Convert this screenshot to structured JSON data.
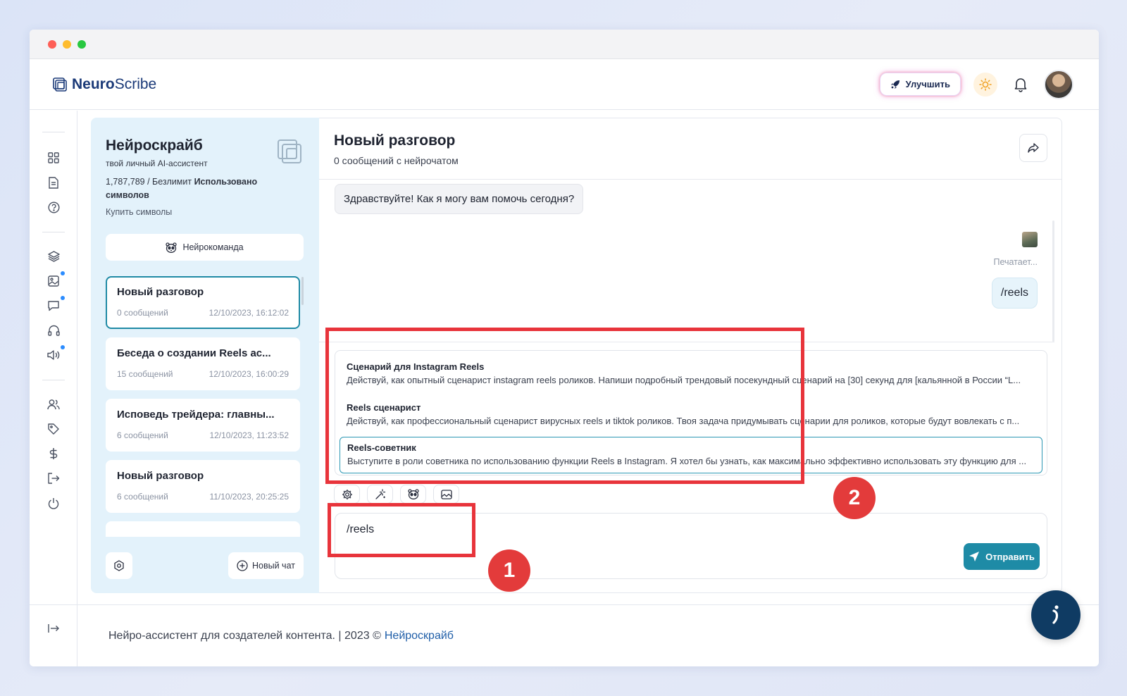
{
  "app": {
    "name_bold": "Neuro",
    "name_rest": "Scribe"
  },
  "header": {
    "upgrade_label": "Улучшить"
  },
  "panel": {
    "title": "Нейроскрайб",
    "subtitle": "твой личный AI-ассистент",
    "usage_count": "1,787,789 / Безлимит ",
    "usage_label": "Использовано символов",
    "buy_label": "Купить символы",
    "team_label": "Нейрокоманда",
    "new_chat_label": "Новый чат",
    "chats": [
      {
        "title": "Новый разговор",
        "count": "0 сообщений",
        "date": "12/10/2023, 16:12:02"
      },
      {
        "title": "Беседа о создании Reels ас...",
        "count": "15 сообщений",
        "date": "12/10/2023, 16:00:29"
      },
      {
        "title": "Исповедь трейдера: главны...",
        "count": "6 сообщений",
        "date": "12/10/2023, 11:23:52"
      },
      {
        "title": "Новый разговор",
        "count": "6 сообщений",
        "date": "11/10/2023, 20:25:25"
      }
    ]
  },
  "chat": {
    "title": "Новый разговор",
    "count": "0 сообщений с нейрочатом",
    "greeting": "Здравствуйте! Как я могу вам помочь сегодня?",
    "typing": "Печатает...",
    "user_message": "/reels",
    "suggestions": [
      {
        "title_pre": "Сценарий для ",
        "title_bold": "Instagram Reels",
        "desc": "Действуй, как опытный сценарист instagram reels роликов. Напиши подробный трендовый посекундный сценарий на [30] секунд для [кальянной в России   “L..."
      },
      {
        "title_pre": "",
        "title_bold": "Reels",
        "title_post": " сценарист",
        "desc": "Действуй, как профессиональный сценарист вирусных reels и tiktok роликов. Твоя задача придумывать сценарии для роликов, которые будут вовлекать с п..."
      },
      {
        "title_pre": "",
        "title_bold": "Reels",
        "title_post": "-советник",
        "desc": "Выступите в роли советника по использованию функции Reels в Instagram. Я хотел бы узнать, как максимально эффективно использовать эту функцию для ..."
      }
    ],
    "input_value": "/reels",
    "send_label": "Отправить"
  },
  "footer": {
    "text": "Нейро-ассистент для создателей контента.  | 2023 © ",
    "link": "Нейроскрайб"
  },
  "annotations": {
    "one": "1",
    "two": "2"
  },
  "colors": {
    "accent": "#1e8ba6",
    "annotation": "#e33b3b",
    "brand": "#1b3a78"
  }
}
